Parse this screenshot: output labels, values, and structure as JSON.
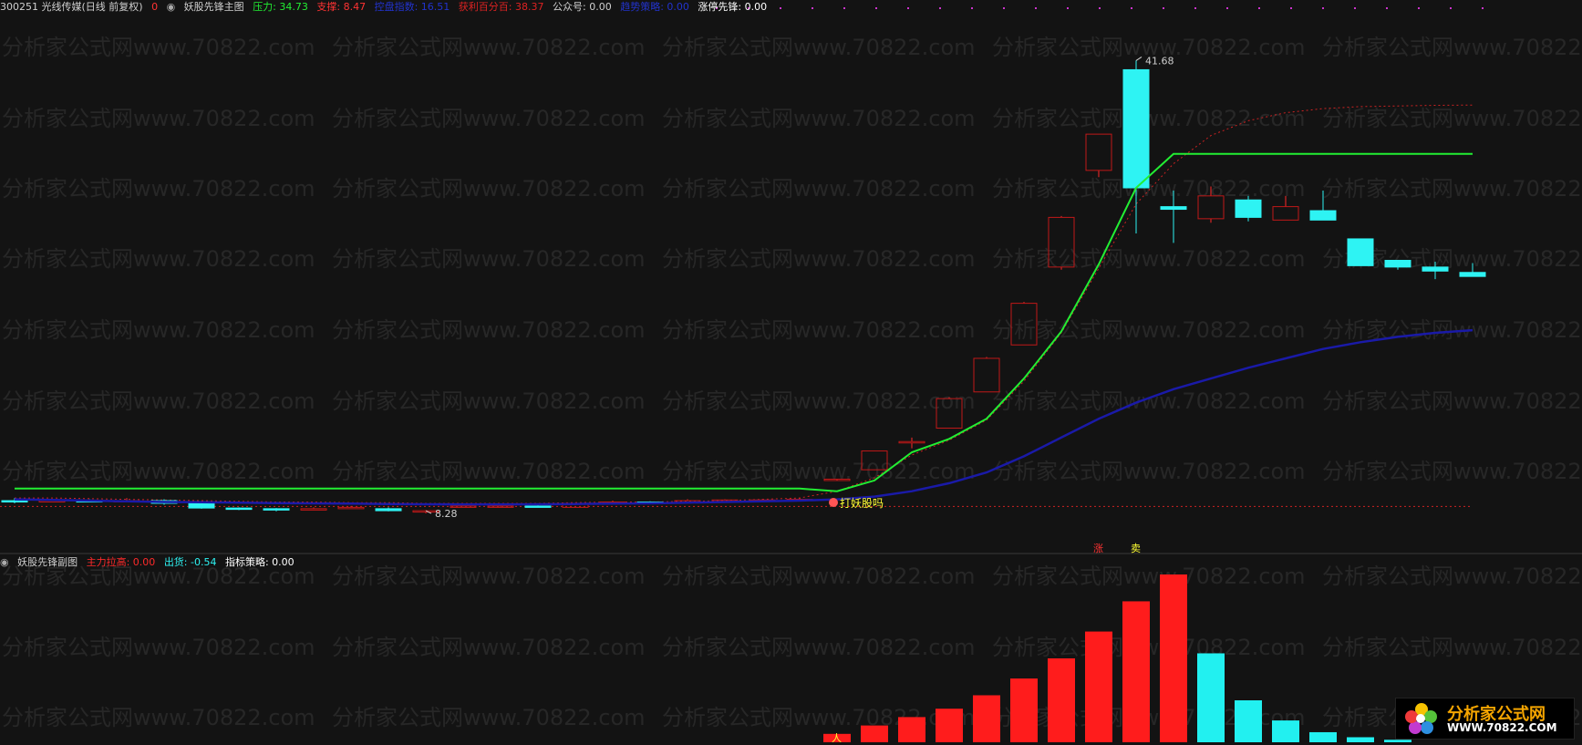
{
  "colors": {
    "up": "#ff2a2a",
    "down": "#2ef3f3",
    "green_line": "#22ee33",
    "blue_line": "#1a1aa8",
    "red_dotted": "#cc2222",
    "bar_up": "#ff1c1c",
    "bar_down": "#22f0f0"
  },
  "header": {
    "stock": "300251 光线传媒(日线 前复权)",
    "zero": "0",
    "indicator_name": "妖股先锋主图",
    "pressure_label": "压力: 34.73",
    "support_label": "支撑: 8.47",
    "blue_label": "控盘指数: 16.51",
    "profit_label": "获利百分百: 38.37",
    "public_label": "公众号: 0.00",
    "ma_label": "趋势策略: 0.00",
    "limit_label": "涨停先锋: 0.00"
  },
  "sub_header": {
    "name": "妖股先锋副图",
    "main_label": "主力拉高: 0.00",
    "out_label": "出货: -0.54",
    "strategy_label": "指标策略: 0.00"
  },
  "annotations": {
    "high_label": "41.68",
    "low_label": "8.28",
    "signal_text": "打妖股吗",
    "zhang_text": "涨",
    "mai_text": "卖",
    "ren_text": "人"
  },
  "watermark": "分析家公式网www.70822.com",
  "logo": {
    "site": "分析家公式网",
    "url": "WWW.70822.COM"
  },
  "chart_data": [
    {
      "type": "candlestick",
      "title": "",
      "ylim": [
        7,
        43
      ],
      "candles": [
        {
          "o": 8.9,
          "h": 9.1,
          "l": 8.7,
          "c": 8.8
        },
        {
          "o": 8.9,
          "h": 9.0,
          "l": 8.8,
          "c": 8.9
        },
        {
          "o": 8.9,
          "h": 9.0,
          "l": 8.8,
          "c": 8.85
        },
        {
          "o": 8.9,
          "h": 9.1,
          "l": 8.8,
          "c": 8.9
        },
        {
          "o": 8.9,
          "h": 9.0,
          "l": 8.6,
          "c": 8.7
        },
        {
          "o": 8.7,
          "h": 8.7,
          "l": 8.3,
          "c": 8.35
        },
        {
          "o": 8.35,
          "h": 8.4,
          "l": 8.2,
          "c": 8.25
        },
        {
          "o": 8.3,
          "h": 8.35,
          "l": 8.1,
          "c": 8.2
        },
        {
          "o": 8.3,
          "h": 8.4,
          "l": 8.2,
          "c": 8.3
        },
        {
          "o": 8.35,
          "h": 8.5,
          "l": 8.3,
          "c": 8.4
        },
        {
          "o": 8.3,
          "h": 8.4,
          "l": 8.1,
          "c": 8.15
        },
        {
          "o": 8.05,
          "h": 8.2,
          "l": 7.95,
          "c": 8.15
        },
        {
          "o": 8.45,
          "h": 8.5,
          "l": 8.4,
          "c": 8.5
        },
        {
          "o": 8.5,
          "h": 8.55,
          "l": 8.45,
          "c": 8.5
        },
        {
          "o": 8.5,
          "h": 8.55,
          "l": 8.4,
          "c": 8.45
        },
        {
          "o": 8.4,
          "h": 8.7,
          "l": 8.4,
          "c": 8.7
        },
        {
          "o": 8.75,
          "h": 8.9,
          "l": 8.7,
          "c": 8.8
        },
        {
          "o": 8.8,
          "h": 8.85,
          "l": 8.65,
          "c": 8.75
        },
        {
          "o": 8.75,
          "h": 9.0,
          "l": 8.7,
          "c": 8.9
        },
        {
          "o": 8.9,
          "h": 9.0,
          "l": 8.8,
          "c": 8.95
        },
        {
          "o": 8.9,
          "h": 9.0,
          "l": 8.8,
          "c": 8.95
        },
        {
          "o": 9.0,
          "h": 9.1,
          "l": 8.9,
          "c": 9.0
        },
        {
          "o": 10.5,
          "h": 10.5,
          "l": 10.5,
          "c": 10.5
        },
        {
          "o": 11.2,
          "h": 12.6,
          "l": 11.2,
          "c": 12.6
        },
        {
          "o": 13.2,
          "h": 13.6,
          "l": 12.8,
          "c": 13.3
        },
        {
          "o": 14.3,
          "h": 16.6,
          "l": 14.3,
          "c": 16.5
        },
        {
          "o": 17.0,
          "h": 19.6,
          "l": 17.0,
          "c": 19.5
        },
        {
          "o": 20.5,
          "h": 23.7,
          "l": 20.5,
          "c": 23.6
        },
        {
          "o": 26.3,
          "h": 30.1,
          "l": 26.1,
          "c": 30.0
        },
        {
          "o": 33.5,
          "h": 36.2,
          "l": 33.0,
          "c": 36.2
        },
        {
          "o": 41.0,
          "h": 41.68,
          "l": 28.8,
          "c": 32.2
        },
        {
          "o": 30.8,
          "h": 32.0,
          "l": 28.1,
          "c": 30.6
        },
        {
          "o": 29.9,
          "h": 32.3,
          "l": 29.6,
          "c": 31.6
        },
        {
          "o": 31.3,
          "h": 31.6,
          "l": 29.7,
          "c": 30.0
        },
        {
          "o": 29.8,
          "h": 31.6,
          "l": 29.8,
          "c": 30.8
        },
        {
          "o": 30.5,
          "h": 32.0,
          "l": 29.8,
          "c": 29.8
        },
        {
          "o": 28.4,
          "h": 28.4,
          "l": 26.4,
          "c": 26.4
        },
        {
          "o": 26.8,
          "h": 26.8,
          "l": 26.1,
          "c": 26.3
        },
        {
          "o": 26.3,
          "h": 26.7,
          "l": 25.4,
          "c": 26.0
        },
        {
          "o": 25.9,
          "h": 26.6,
          "l": 25.6,
          "c": 25.6
        }
      ],
      "series": [
        {
          "name": "压力",
          "values": [
            9.8,
            9.8,
            9.8,
            9.8,
            9.8,
            9.8,
            9.8,
            9.8,
            9.8,
            9.8,
            9.8,
            9.8,
            9.8,
            9.8,
            9.8,
            9.8,
            9.8,
            9.8,
            9.8,
            9.8,
            9.8,
            9.8,
            9.6,
            10.4,
            12.5,
            13.5,
            15.0,
            18.0,
            21.5,
            26.5,
            32.2,
            34.73,
            34.73,
            34.73,
            34.73,
            34.73,
            34.73,
            34.73,
            34.73,
            34.73
          ]
        },
        {
          "name": "支撑",
          "values": [
            9.0,
            8.95,
            8.9,
            8.85,
            8.8,
            8.78,
            8.75,
            8.72,
            8.7,
            8.68,
            8.65,
            8.63,
            8.62,
            8.62,
            8.63,
            8.65,
            8.68,
            8.7,
            8.75,
            8.8,
            8.85,
            8.9,
            9.0,
            9.2,
            9.6,
            10.2,
            11.0,
            12.2,
            13.6,
            15.0,
            16.2,
            17.2,
            18.0,
            18.8,
            19.5,
            20.2,
            20.7,
            21.1,
            21.4,
            21.6
          ]
        },
        {
          "name": "获利百分百",
          "values": [
            9.1,
            9.1,
            9.05,
            9.0,
            8.95,
            8.9,
            8.85,
            8.8,
            8.8,
            8.75,
            8.75,
            8.7,
            8.7,
            8.7,
            8.7,
            8.75,
            8.8,
            8.8,
            8.85,
            8.9,
            9.0,
            9.1,
            9.6,
            10.6,
            12.3,
            13.4,
            14.9,
            17.8,
            21.4,
            26.2,
            31.0,
            34.0,
            36.1,
            37.2,
            37.8,
            38.1,
            38.25,
            38.3,
            38.35,
            38.37
          ]
        }
      ],
      "support_const": 8.47
    },
    {
      "type": "bar",
      "title": "妖股先锋副图",
      "ylim": [
        0,
        10
      ],
      "values": [
        0,
        0,
        0,
        0,
        0,
        0,
        0,
        0,
        0,
        0,
        0,
        0,
        0,
        0,
        0,
        0,
        0,
        0,
        0,
        0,
        0,
        0,
        0.5,
        1.0,
        1.5,
        2.0,
        2.8,
        3.8,
        5.0,
        6.6,
        8.4,
        10.0,
        5.3,
        2.5,
        1.3,
        0.6,
        0.3,
        0.15,
        0,
        0
      ],
      "colors": [
        "up",
        "up",
        "up",
        "up",
        "up",
        "up",
        "up",
        "up",
        "up",
        "up",
        "up",
        "up",
        "up",
        "up",
        "up",
        "up",
        "up",
        "up",
        "up",
        "up",
        "up",
        "up",
        "up",
        "up",
        "up",
        "up",
        "up",
        "up",
        "up",
        "up",
        "up",
        "up",
        "down",
        "down",
        "down",
        "down",
        "down",
        "down",
        "down",
        "down"
      ]
    }
  ]
}
